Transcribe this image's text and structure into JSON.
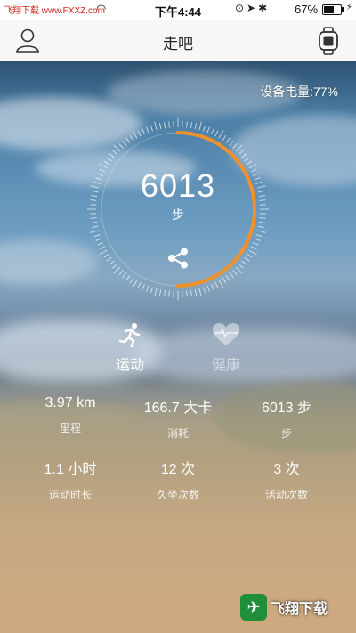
{
  "status_bar": {
    "watermark": "飞翔下载 www.FXXZ.com",
    "time": "下午4:44",
    "battery_percent": "67%",
    "battery_level": 0.67
  },
  "nav": {
    "title": "走吧",
    "left_icon": "user-icon",
    "right_icon": "watch-icon"
  },
  "device": {
    "battery_label": "设备电量:77%"
  },
  "summary": {
    "steps": "6013",
    "steps_unit": "步",
    "progress": 0.5,
    "accent_color": "#f0922a"
  },
  "tabs": [
    {
      "label": "运动",
      "icon": "running-icon",
      "active": true
    },
    {
      "label": "健康",
      "icon": "heart-icon",
      "active": false
    }
  ],
  "stats": [
    {
      "value": "3.97 km",
      "label": "里程"
    },
    {
      "value": "166.7 大卡",
      "label": "消耗"
    },
    {
      "value": "6013 步",
      "label": "步"
    },
    {
      "value": "1.1 小时",
      "label": "运动时长"
    },
    {
      "value": "12 次",
      "label": "久坐次数"
    },
    {
      "value": "3 次",
      "label": "活动次数"
    }
  ],
  "watermark_bottom": {
    "text": "飞翔下载",
    "site": "www.FXXZ.com"
  }
}
